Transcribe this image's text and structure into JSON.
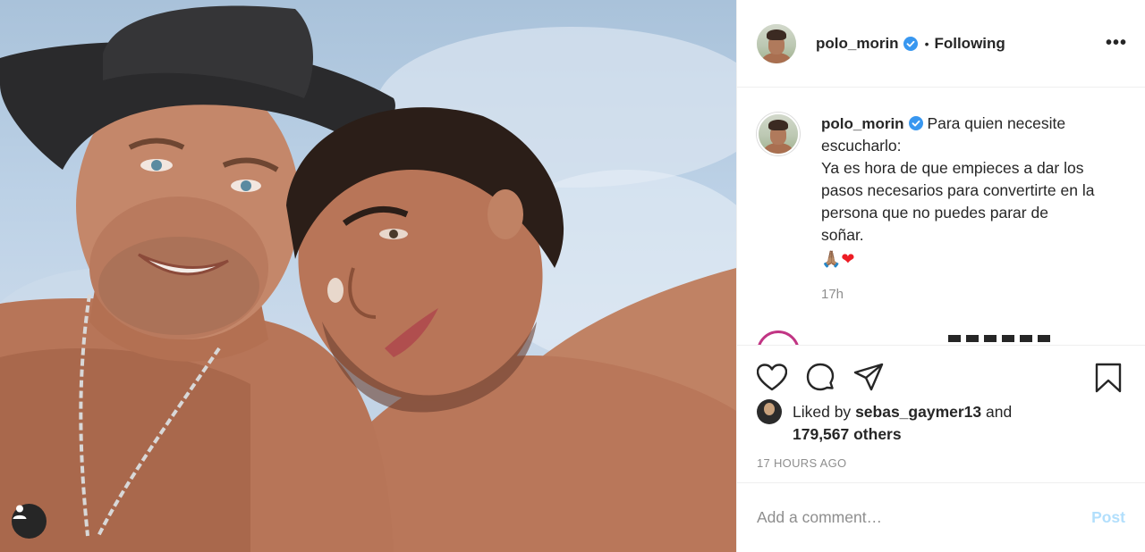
{
  "header": {
    "username": "polo_morin",
    "separator": "•",
    "follow_status": "Following",
    "more_label": "•••"
  },
  "caption": {
    "username": "polo_morin",
    "lines": [
      "Para quien necesite",
      "escucharlo:",
      "Ya es hora de que empieces a dar los",
      "pasos necesarios para convertirte en la",
      "persona que no puedes parar de",
      "soñar."
    ],
    "emoji": "🙏🏽",
    "heart": "❤",
    "time": "17h"
  },
  "likes": {
    "prefix": "Liked by",
    "liker": "sebas_gaymer13",
    "joiner": "and",
    "others": "179,567 others"
  },
  "timestamp": "17 HOURS AGO",
  "comment_box": {
    "placeholder": "Add a comment…",
    "post_label": "Post"
  },
  "colors": {
    "verified_blue": "#3897f0",
    "post_button_disabled": "#b2dffc",
    "story_ring": "#c13584",
    "muted_text": "#8e8e8e"
  },
  "icons": [
    "heart-icon",
    "comment-icon",
    "share-icon",
    "bookmark-icon",
    "user-tag-icon",
    "verified-badge-icon",
    "more-options-icon"
  ]
}
